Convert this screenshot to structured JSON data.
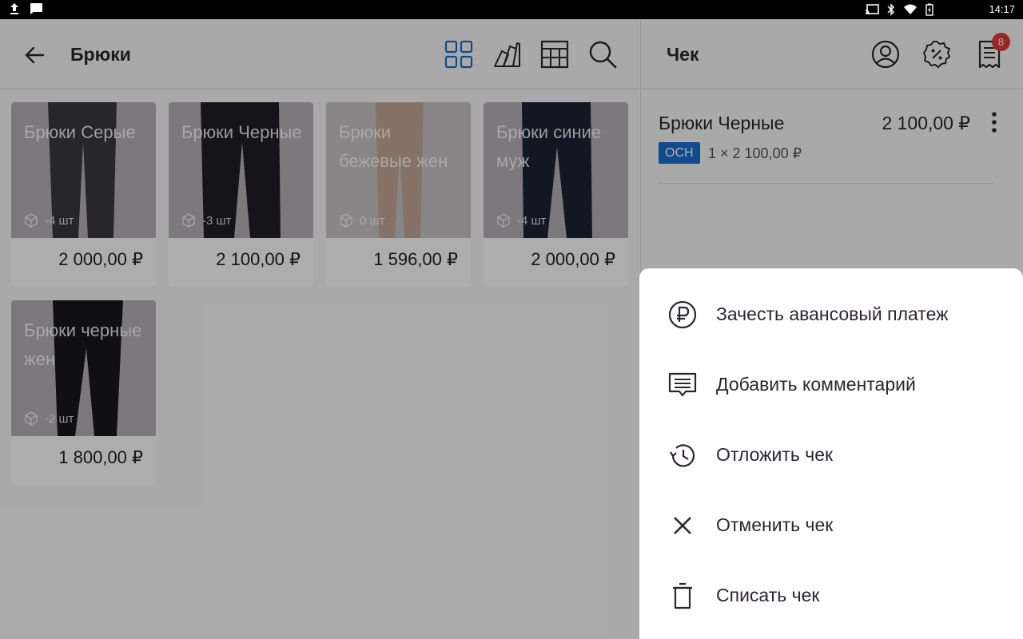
{
  "status_bar": {
    "time": "14:17",
    "icons": [
      "upload-icon",
      "message-icon",
      "cast-icon",
      "bluetooth-icon",
      "wifi-icon",
      "battery-icon"
    ]
  },
  "catalog": {
    "title": "Брюки",
    "tools": [
      "grid-view-icon",
      "category-icon",
      "table-view-icon",
      "search-icon"
    ],
    "products": [
      {
        "name": "Брюки Серые",
        "stock": "-4 шт",
        "price": "2 000,00 ₽",
        "color": "#3a3a3e"
      },
      {
        "name": "Брюки Черные",
        "stock": "-3 шт",
        "price": "2 100,00 ₽",
        "color": "#1f2026"
      },
      {
        "name": "Брюки бежевые жен",
        "stock": "0 шт",
        "price": "1 596,00 ₽",
        "color": "#c8a89a"
      },
      {
        "name": "Брюки синие муж",
        "stock": "-4 шт",
        "price": "2 000,00 ₽",
        "color": "#1c2236"
      },
      {
        "name": "Брюки черные жен",
        "stock": "-2 шт",
        "price": "1 800,00 ₽",
        "color": "#18181c"
      }
    ]
  },
  "receipt": {
    "title": "Чек",
    "badge_count": "8",
    "item": {
      "name": "Брюки Черные",
      "price": "2 100,00 ₽",
      "tax": "ОСН",
      "qty": "1 × 2 100,00 ₽"
    }
  },
  "menu": {
    "items": [
      {
        "label": "Зачесть авансовый платеж",
        "icon": "ruble-circle-icon"
      },
      {
        "label": "Добавить комментарий",
        "icon": "comment-icon"
      },
      {
        "label": "Отложить чек",
        "icon": "history-icon"
      },
      {
        "label": "Отменить чек",
        "icon": "close-icon"
      },
      {
        "label": "Списать чек",
        "icon": "trash-icon"
      }
    ]
  },
  "colors": {
    "accent": "#1a6fd1",
    "badge": "#e53935",
    "menu_text": "#2e2433"
  }
}
